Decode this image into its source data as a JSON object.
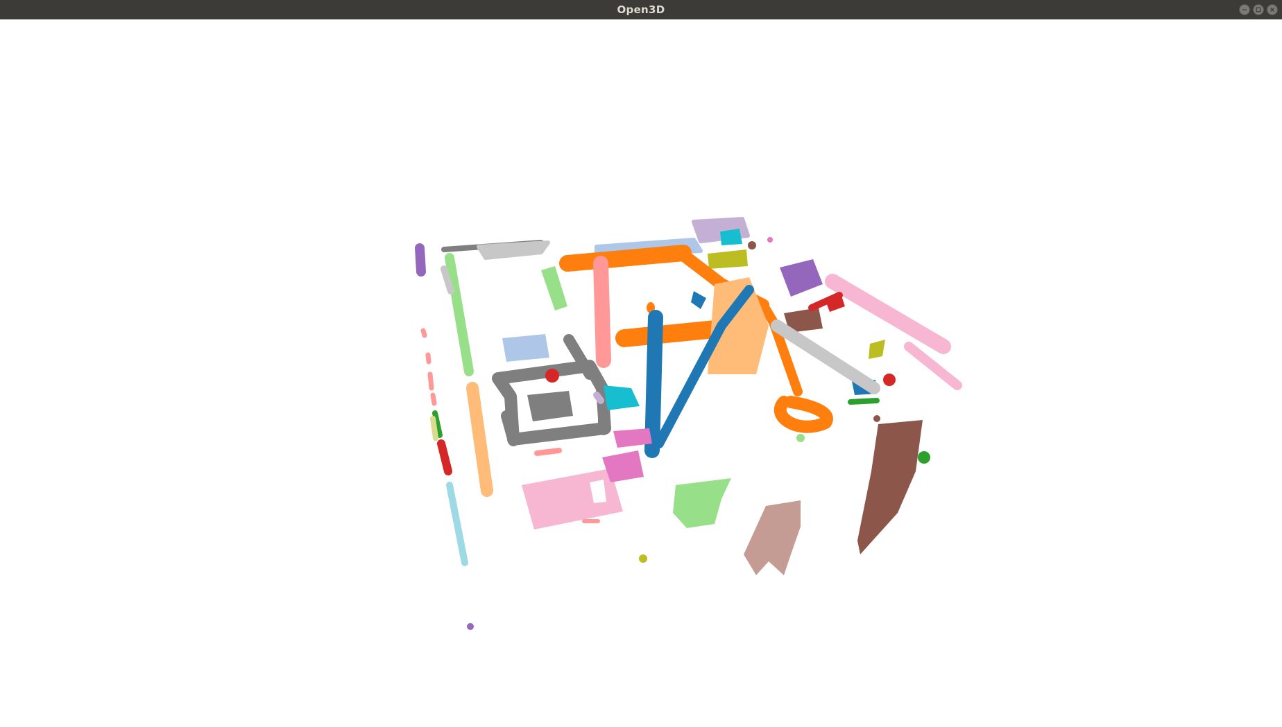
{
  "window": {
    "title": "Open3D",
    "controls": [
      "minimize-icon",
      "maximize-icon",
      "close-icon"
    ]
  },
  "scene": {
    "background": "#ffffff",
    "palette": {
      "blue": "#1f77b4",
      "orange": "#ff7f0e",
      "green": "#2ca02c",
      "red": "#d62728",
      "purple": "#9467bd",
      "brown": "#8c564b",
      "pink": "#e377c2",
      "gray": "#7f7f7f",
      "olive": "#bcbd22",
      "cyan": "#17becf",
      "light_blue": "#aec7e8",
      "light_orange": "#ffbb78",
      "light_green": "#98df8a",
      "salmon": "#ff9896",
      "lavender": "#c5b0d5",
      "tan": "#c49c94",
      "light_pink": "#f7b6d2",
      "light_gray": "#c7c7c7",
      "khaki": "#dbdb8d",
      "sky": "#9edae5"
    }
  }
}
